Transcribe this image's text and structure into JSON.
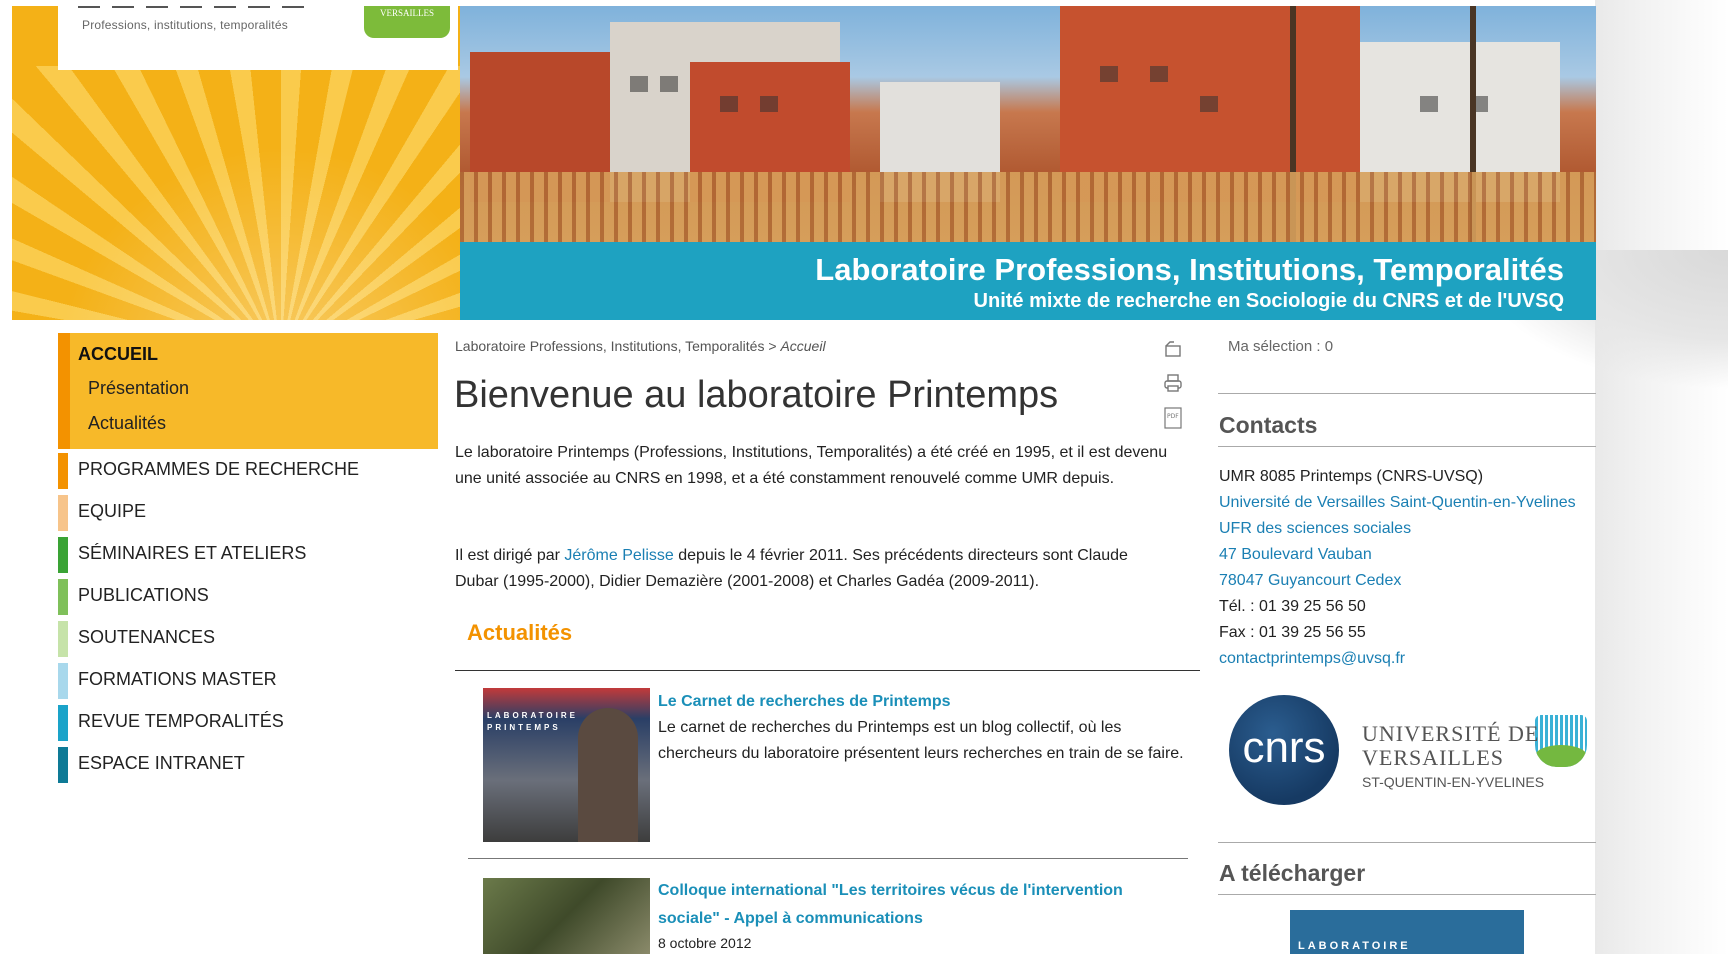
{
  "header": {
    "logo_subtitle": "Professions, institutions, temporalités",
    "uvsq_badge": "VERSAILLES",
    "lab_title": "Laboratoire Professions, Institutions, Temporalités",
    "lab_subtitle": "Unité mixte de recherche en Sociologie du CNRS et de l'UVSQ"
  },
  "nav": {
    "active": {
      "label": "ACCUEIL",
      "subitems": [
        "Présentation",
        "Actualités"
      ]
    },
    "items": [
      {
        "label": "PROGRAMMES DE RECHERCHE",
        "color": "#f39200"
      },
      {
        "label": "EQUIPE",
        "color": "#f7c48a"
      },
      {
        "label": "SÉMINAIRES ET ATELIERS",
        "color": "#3aa335"
      },
      {
        "label": "PUBLICATIONS",
        "color": "#7fc05a"
      },
      {
        "label": "SOUTENANCES",
        "color": "#c6e3a9"
      },
      {
        "label": "FORMATIONS MASTER",
        "color": "#a8d8ec"
      },
      {
        "label": "REVUE TEMPORALITÉS",
        "color": "#1aa3c9"
      },
      {
        "label": "ESPACE INTRANET",
        "color": "#0e7a96"
      }
    ]
  },
  "main": {
    "breadcrumb_root": "Laboratoire Professions, Institutions, Temporalités",
    "breadcrumb_sep": " > ",
    "breadcrumb_current": "Accueil",
    "title": "Bienvenue au laboratoire Printemps",
    "para1": "Le laboratoire Printemps (Professions, Institutions, Temporalités) a été créé en 1995, et il est devenu une unité associée au CNRS en 1998, et a été constamment renouvelé comme UMR depuis.",
    "para2_before": "Il est dirigé par ",
    "para2_link": "Jérôme Pelisse",
    "para2_after": " depuis le 4 février 2011. Ses précédents directeurs sont Claude Dubar (1995-2000), Didier Demazière (2001-2008) et Charles Gadéa (2009-2011).",
    "news_heading": "Actualités",
    "news": [
      {
        "title": "Le Carnet de recherches de Printemps",
        "text": "Le carnet de recherches du Printemps est un blog collectif, où les chercheurs du laboratoire présentent leurs recherches en train de se faire.",
        "thumb_text": "LABORATOIRE PRINTEMPS"
      },
      {
        "title": "Colloque international \"Les territoires vécus de l'intervention sociale\" - Appel à communications",
        "date": "8 octobre 2012"
      }
    ]
  },
  "right": {
    "selection": "Ma sélection : 0",
    "contacts_title": "Contacts",
    "contact_lines": [
      {
        "text": "UMR 8085 Printemps (CNRS-UVSQ)",
        "link": false
      },
      {
        "text": "Université de Versailles Saint-Quentin-en-Yvelines",
        "link": true
      },
      {
        "text": "UFR des sciences sociales",
        "link": true
      },
      {
        "text": "47 Boulevard Vauban",
        "link": true
      },
      {
        "text": "78047 Guyancourt Cedex",
        "link": true
      },
      {
        "text": "Tél. : 01 39 25 56 50",
        "link": false
      },
      {
        "text": "Fax : 01 39 25 56 55",
        "link": false
      },
      {
        "text": "contactprintemps@uvsq.fr",
        "link": true
      }
    ],
    "cnrs_logo": "cnrs",
    "uvsq_line1": "UNIVERSITÉ DE",
    "uvsq_line2": "VERSAILLES",
    "uvsq_line3": "ST-QUENTIN-EN-YVELINES",
    "download_title": "A télécharger",
    "download_thumb_text": "LABORATOIRE"
  },
  "icons": {
    "share": "share-icon",
    "print": "print-icon",
    "pdf": "pdf-icon"
  }
}
